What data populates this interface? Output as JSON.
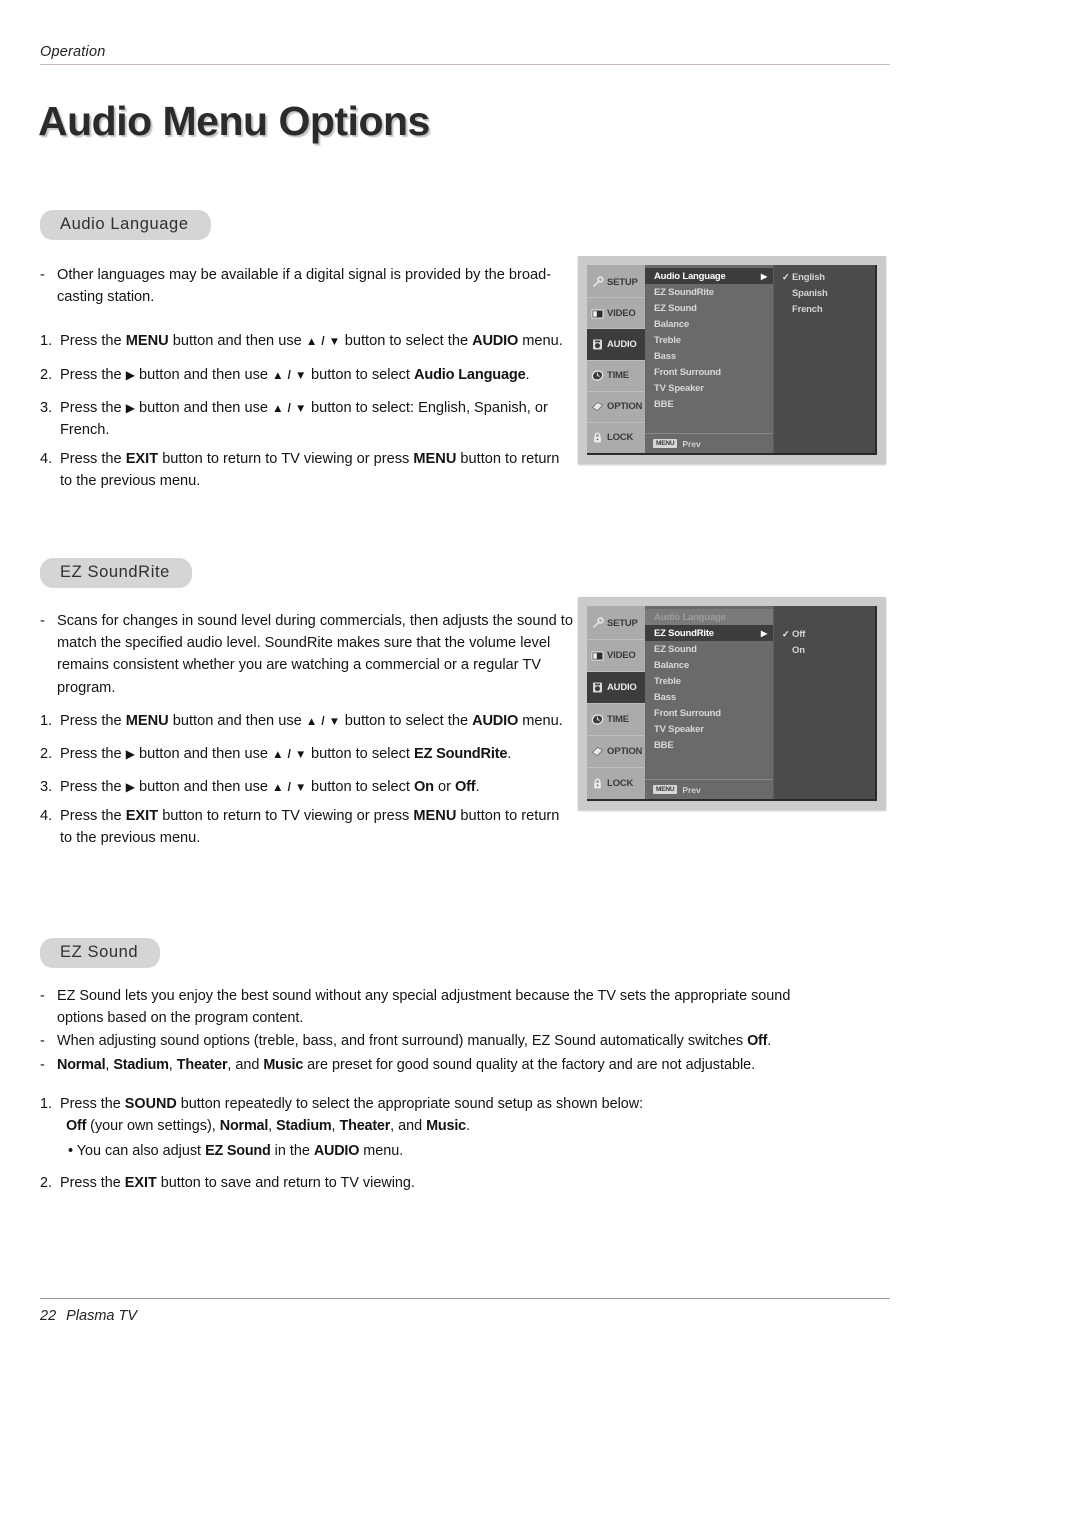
{
  "header": {
    "label": "Operation"
  },
  "page_title": "Audio Menu Options",
  "sections": {
    "audio_language": {
      "pill": "Audio Language",
      "dash_1": "Other languages may be available if a digital signal is provided by the broad-casting station.",
      "step_1_a": "Press the ",
      "step_1_menu": "MENU",
      "step_1_b": " button and then use ",
      "step_1_updown": "▲ / ▼",
      "step_1_c": " button to select the ",
      "step_1_audio": "AUDIO",
      "step_1_d": " menu.",
      "step_2_a": "Press the ",
      "step_2_arrow": "▶",
      "step_2_b": " button and then use ",
      "step_2_updown": "▲ / ▼",
      "step_2_c": " button to select ",
      "step_2_target": "Audio Language",
      "step_2_d": ".",
      "step_3_a": "Press the ",
      "step_3_arrow": "▶",
      "step_3_b": " button and then use ",
      "step_3_updown": "▲ / ▼",
      "step_3_c": " button to select: English, Spanish, or French.",
      "step_4_a": "Press the ",
      "step_4_exit": "EXIT",
      "step_4_b": " button to return to TV viewing or press ",
      "step_4_menu": "MENU",
      "step_4_c": " button to return to the previous menu."
    },
    "ez_soundrite": {
      "pill": "EZ SoundRite",
      "dash_1": "Scans for changes in sound level during commercials, then adjusts the sound to match the specified audio level. SoundRite makes sure that the volume level remains consistent whether you are watching a commercial or a regular TV program.",
      "step_1_a": "Press the ",
      "step_1_menu": "MENU",
      "step_1_b": " button and then use ",
      "step_1_updown": "▲ / ▼",
      "step_1_c": " button to select the ",
      "step_1_audio": "AUDIO",
      "step_1_d": " menu.",
      "step_2_a": "Press the ",
      "step_2_arrow": "▶",
      "step_2_b": " button and then use ",
      "step_2_updown": "▲ / ▼",
      "step_2_c": " button to select ",
      "step_2_target": "EZ SoundRite",
      "step_2_d": ".",
      "step_3_a": "Press the ",
      "step_3_arrow": "▶",
      "step_3_b": " button and then use ",
      "step_3_updown": "▲ / ▼",
      "step_3_c": " button to select ",
      "step_3_on": "On",
      "step_3_or": " or ",
      "step_3_off": "Off",
      "step_3_d": ".",
      "step_4_a": "Press the ",
      "step_4_exit": "EXIT",
      "step_4_b": " button to return to TV viewing or press ",
      "step_4_menu": "MENU",
      "step_4_c": " button to return to the previous menu."
    },
    "ez_sound": {
      "pill": "EZ Sound",
      "dash_1": "EZ Sound lets you enjoy the best sound without any special adjustment because the TV sets the appropriate sound options based on the program content.",
      "dash_2_a": "When adjusting sound options (treble, bass, and front surround) manually, EZ Sound automatically switches ",
      "dash_2_off": "Off",
      "dash_2_b": ".",
      "dash_3_normal": "Normal",
      "dash_3_c1": ", ",
      "dash_3_stadium": "Stadium",
      "dash_3_c2": ", ",
      "dash_3_theater": "Theater",
      "dash_3_c3": ", and ",
      "dash_3_music": "Music",
      "dash_3_tail": " are preset for good sound quality at the factory and are not adjustable.",
      "step_1_a": "Press the ",
      "step_1_sound": "SOUND",
      "step_1_b": " button repeatedly to select the appropriate sound setup as shown below:",
      "step_1_line2_off": "Off",
      "step_1_line2_a": " (your own settings), ",
      "step_1_line2_normal": "Normal",
      "step_1_line2_c1": ", ",
      "step_1_line2_stadium": "Stadium",
      "step_1_line2_c2": ", ",
      "step_1_line2_theater": "Theater",
      "step_1_line2_c3": ", and ",
      "step_1_line2_music": "Music",
      "step_1_line2_end": ".",
      "bullet_a": "• You can also adjust ",
      "bullet_ezsound": "EZ Sound",
      "bullet_b": " in the ",
      "bullet_audio": "AUDIO",
      "bullet_c": " menu.",
      "step_2_a": "Press the ",
      "step_2_exit": "EXIT",
      "step_2_b": " button to save and return to TV viewing."
    }
  },
  "osd": {
    "sidebar": [
      {
        "label": "SETUP",
        "icon": "wrench-icon",
        "active": false
      },
      {
        "label": "VIDEO",
        "icon": "monitor-icon",
        "active": false
      },
      {
        "label": "AUDIO",
        "icon": "speaker-icon",
        "active": true
      },
      {
        "label": "TIME",
        "icon": "clock-icon",
        "active": false
      },
      {
        "label": "OPTION",
        "icon": "tag-icon",
        "active": false
      },
      {
        "label": "LOCK",
        "icon": "padlock-icon",
        "active": false
      }
    ],
    "menu_items": [
      "Audio Language",
      "EZ SoundRite",
      "EZ Sound",
      "Balance",
      "Treble",
      "Bass",
      "Front Surround",
      "TV Speaker",
      "BBE"
    ],
    "footer_badge": "MENU",
    "footer_text": "Prev",
    "caret": "▶",
    "check": "✓",
    "screen1": {
      "highlight_index": 0,
      "dim_index": -1,
      "options": [
        "English",
        "Spanish",
        "French"
      ],
      "selected_option": "English"
    },
    "screen2": {
      "highlight_index": 1,
      "dim_index": 0,
      "options": [
        "Off",
        "On"
      ],
      "selected_option": "Off"
    }
  },
  "footer": {
    "page_number": "22",
    "product": "Plasma TV"
  },
  "colors": {
    "pill_bg": "#d5d5d5",
    "osd_frame": "#c9cbcd",
    "osd_sidebar": "#a9abad",
    "osd_list": "#6a6a6a",
    "osd_panel": "#4b4b4b",
    "osd_highlight": "#3d3d3d",
    "header_rule": "#c8b8bd"
  }
}
